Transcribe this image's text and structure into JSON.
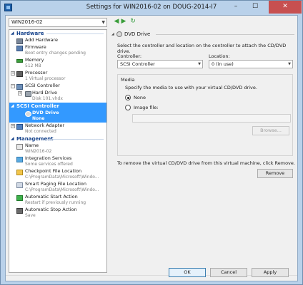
{
  "window": {
    "title": "Settings for WIN2016-02 on DOUG-2014-I7",
    "minimize_glyph": "–",
    "maximize_glyph": "☐",
    "close_glyph": "✕"
  },
  "vm_selector": {
    "value": "WIN2016-02"
  },
  "sidebar": {
    "hardware_header": "Hardware",
    "hardware_items": [
      {
        "name": "Add Hardware",
        "sub": "",
        "icon": "add-hardware-icon"
      },
      {
        "name": "Firmware",
        "sub": "Boot entry changes pending",
        "icon": "firmware-icon"
      },
      {
        "name": "Memory",
        "sub": "512 MB",
        "icon": "memory-icon"
      },
      {
        "name": "Processor",
        "sub": "1 Virtual processor",
        "icon": "processor-icon"
      },
      {
        "name": "SCSI Controller",
        "sub": "",
        "icon": "scsi-controller-icon"
      },
      {
        "name": "Hard Drive",
        "sub": "Disk 101.vhdx",
        "icon": "hard-drive-icon"
      }
    ],
    "selected_group": "SCSI Controller",
    "selected_item": {
      "name": "DVD Drive",
      "sub": "None",
      "icon": "dvd-drive-icon"
    },
    "network_item": {
      "name": "Network Adapter",
      "sub": "Not connected",
      "icon": "network-adapter-icon"
    },
    "management_header": "Management",
    "management_items": [
      {
        "name": "Name",
        "sub": "WIN2016-02",
        "icon": "name-icon"
      },
      {
        "name": "Integration Services",
        "sub": "Some services offered",
        "icon": "integration-services-icon"
      },
      {
        "name": "Checkpoint File Location",
        "sub": "C:\\ProgramData\\Microsoft\\Windo...",
        "icon": "checkpoint-icon"
      },
      {
        "name": "Smart Paging File Location",
        "sub": "C:\\ProgramData\\Microsoft\\Windo...",
        "icon": "smart-paging-icon"
      },
      {
        "name": "Automatic Start Action",
        "sub": "Restart if previously running",
        "icon": "start-action-icon"
      },
      {
        "name": "Automatic Stop Action",
        "sub": "Save",
        "icon": "stop-action-icon"
      }
    ]
  },
  "panel": {
    "header": "DVD Drive",
    "description": "Select the controller and location on the controller to attach the CD/DVD drive.",
    "controller_label": "Controller:",
    "controller_value": "SCSI Controller",
    "location_label": "Location:",
    "location_value": "0 (in use)",
    "media_title": "Media",
    "media_desc": "Specify the media to use with your virtual CD/DVD drive.",
    "none_label": "None",
    "image_label": "Image file:",
    "image_path": "",
    "browse_label": "Browse...",
    "remove_note": "To remove the virtual CD/DVD drive from this virtual machine, click Remove.",
    "remove_label": "Remove"
  },
  "footer": {
    "ok_label": "OK",
    "cancel_label": "Cancel",
    "apply_label": "Apply"
  },
  "colors": {
    "selection": "#3399ff",
    "section_header": "#15428b",
    "title_bar": "#b9d1ea",
    "close_button": "#c75050"
  }
}
